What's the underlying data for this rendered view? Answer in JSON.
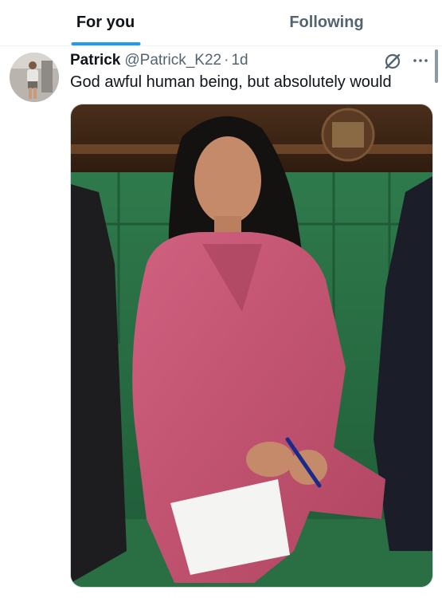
{
  "tabs": [
    {
      "label": "For you",
      "active": true
    },
    {
      "label": "Following",
      "active": false
    }
  ],
  "accent_color": "#1d9bf0",
  "post": {
    "display_name": "Patrick",
    "handle": "@Patrick_K22",
    "separator": "·",
    "time": "1d",
    "text": "God awful human being, but absolutely would",
    "icons": [
      "avatar-photo",
      "grok-icon",
      "more-icon"
    ],
    "media": {
      "type": "photo",
      "description_color_coat": "#c2506e"
    }
  }
}
